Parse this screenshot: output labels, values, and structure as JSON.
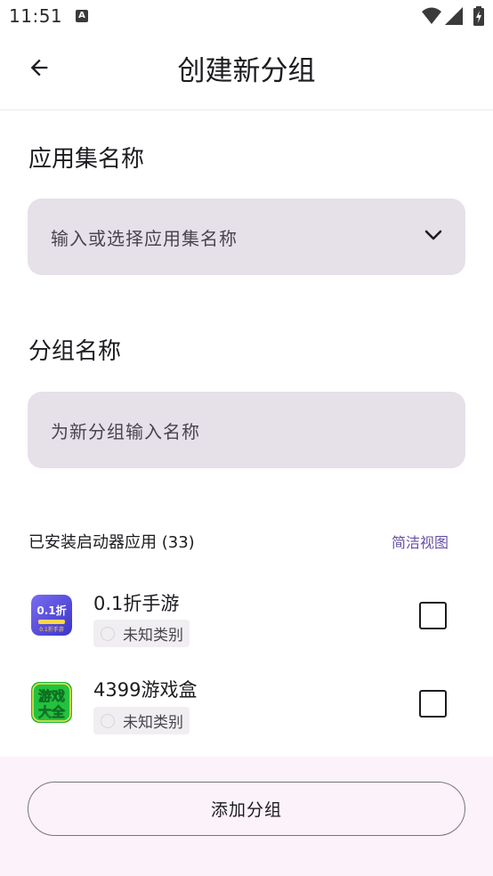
{
  "status_bar": {
    "time": "11:51",
    "icons": [
      "a-notification-icon",
      "wifi-icon",
      "signal-icon",
      "battery-charging-icon"
    ]
  },
  "app_bar": {
    "back_icon": "arrow-left-icon",
    "title": "创建新分组"
  },
  "collection": {
    "label": "应用集名称",
    "placeholder": "输入或选择应用集名称",
    "dropdown_icon": "chevron-down-icon"
  },
  "group": {
    "label": "分组名称",
    "placeholder": "为新分组输入名称"
  },
  "apps_section": {
    "header": "已安装启动器应用 (33)",
    "view_toggle": "简洁视图"
  },
  "apps": [
    {
      "name": "0.1折手游",
      "category": "未知类别",
      "checked": false,
      "icon_text": "0.1折",
      "icon_subtext": "0.1折手游"
    },
    {
      "name": "4399游戏盒",
      "category": "未知类别",
      "checked": false,
      "icon_text": "游戏",
      "icon_subtext": "大全"
    }
  ],
  "footer": {
    "add_button": "添加分组"
  },
  "colors": {
    "field_bg": "#e6e0e9",
    "accent": "#6750a4",
    "bottom_bar_bg": "#fbf2fa"
  }
}
